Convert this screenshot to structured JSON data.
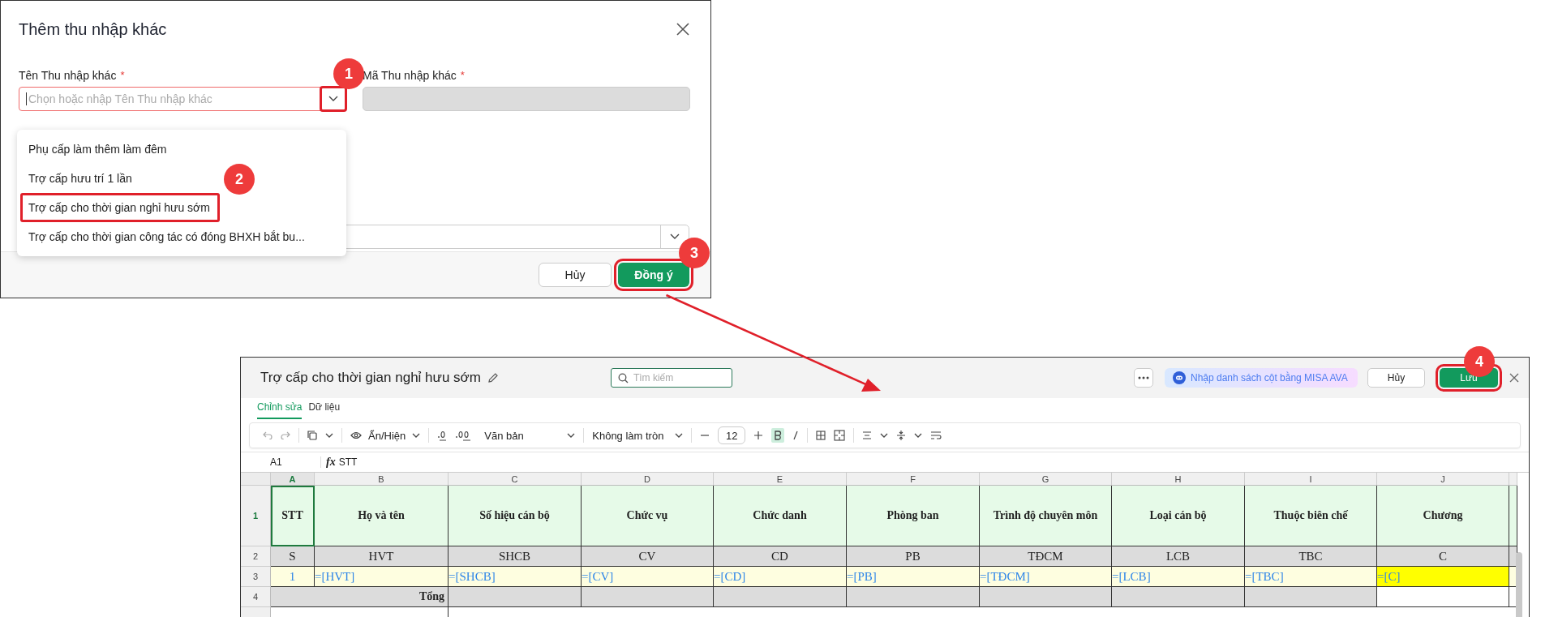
{
  "dialog": {
    "title": "Thêm thu nhập khác",
    "fields": [
      {
        "label": "Tên Thu nhập khác",
        "required_mark": "*",
        "placeholder": "Chọn hoặc nhập Tên Thu nhập khác",
        "kind": "combo",
        "error": true,
        "chevron_outlined": true
      },
      {
        "label": "Mã Thu nhập khác",
        "required_mark": "*",
        "kind": "locked"
      }
    ],
    "options": [
      {
        "label": "Phụ cấp làm thêm làm đêm",
        "outlined": false
      },
      {
        "label": "Trợ cấp hưu trí 1 lần",
        "outlined": false
      },
      {
        "label": "Trợ cấp cho thời gian nghỉ hưu sớm",
        "outlined": true
      },
      {
        "label": "Trợ cấp cho thời gian công tác có đóng BHXH bắt bu...",
        "outlined": false
      }
    ],
    "buttons": [
      {
        "label": "Hủy",
        "kind": "secondary",
        "outlined": false
      },
      {
        "label": "Đồng ý",
        "kind": "primary",
        "outlined": true
      }
    ]
  },
  "editor": {
    "title": "Trợ cấp cho thời gian nghỉ hưu sớm",
    "search_placeholder": "Tìm kiếm",
    "ava_button": "Nhập danh sách cột bằng MISA AVA",
    "buttons": [
      {
        "label": "Hủy",
        "kind": "secondary",
        "outlined": false
      },
      {
        "label": "Lưu",
        "kind": "primary",
        "outlined": true
      }
    ],
    "tabs": [
      {
        "label": "Chỉnh sửa",
        "selected": true
      },
      {
        "label": "Dữ liệu",
        "selected": false
      }
    ],
    "toolbar": {
      "show_hide": "Ẩn/Hiện",
      "format": "Văn bản",
      "rounding": "Không làm tròn",
      "font_size": "12",
      "bold": true
    },
    "cell_ref": "A1",
    "fx": "fx",
    "formula": "STT",
    "columns": [
      {
        "label": "A",
        "selected": true
      },
      {
        "label": "B",
        "selected": false
      },
      {
        "label": "C",
        "selected": false
      },
      {
        "label": "D",
        "selected": false
      },
      {
        "label": "E",
        "selected": false
      },
      {
        "label": "F",
        "selected": false
      },
      {
        "label": "G",
        "selected": false
      },
      {
        "label": "H",
        "selected": false
      },
      {
        "label": "I",
        "selected": false
      },
      {
        "label": "J",
        "selected": false
      }
    ],
    "row_numbers": [
      {
        "label": "1",
        "selected": true
      },
      {
        "label": "2",
        "selected": false
      },
      {
        "label": "3",
        "selected": false
      },
      {
        "label": "4",
        "selected": false
      }
    ],
    "headers": [
      "STT",
      "Họ và tên",
      "Số hiệu cán bộ",
      "Chức vụ",
      "Chức danh",
      "Phòng ban",
      "Trình độ chuyên môn",
      "Loại cán bộ",
      "Thuộc biên chế",
      "Chương"
    ],
    "codes": [
      "S",
      "HVT",
      "SHCB",
      "CV",
      "CD",
      "PB",
      "TĐCM",
      "LCB",
      "TBC",
      "C"
    ],
    "formulas": [
      {
        "text": "1",
        "highlighted": false
      },
      {
        "text": "=[HVT]",
        "highlighted": false
      },
      {
        "text": "=[SHCB]",
        "highlighted": false
      },
      {
        "text": "=[CV]",
        "highlighted": false
      },
      {
        "text": "=[CD]",
        "highlighted": false
      },
      {
        "text": "=[PB]",
        "highlighted": false
      },
      {
        "text": "=[TĐCM]",
        "highlighted": false
      },
      {
        "text": "=[LCB]",
        "highlighted": false
      },
      {
        "text": "=[TBC]",
        "highlighted": false
      },
      {
        "text": "=[C]",
        "highlighted": true
      }
    ],
    "total_label": "Tổng",
    "total_cells": [
      {
        "filled": true
      },
      {
        "filled": true
      },
      {
        "filled": true
      },
      {
        "filled": true
      },
      {
        "filled": true
      },
      {
        "filled": true
      },
      {
        "filled": true
      },
      {
        "filled": false
      }
    ]
  },
  "steps": [
    "1",
    "2",
    "3",
    "4"
  ]
}
